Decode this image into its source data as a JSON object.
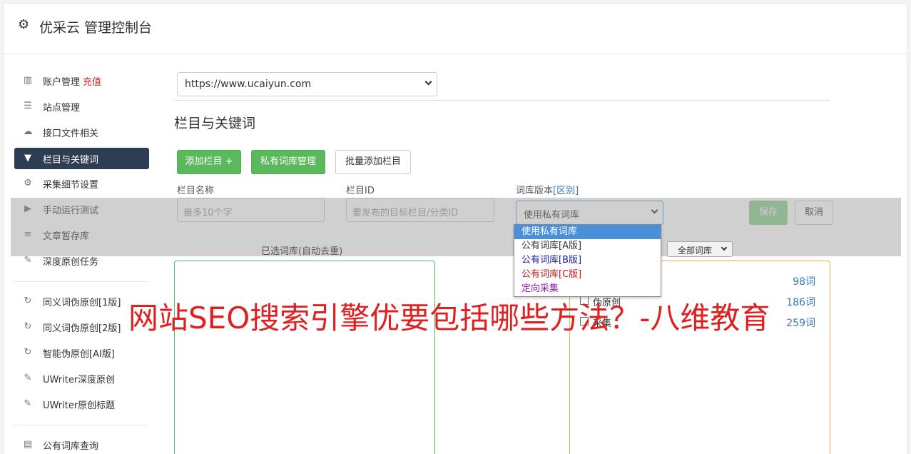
{
  "header": {
    "title": "优采云 管理控制台",
    "icon": "gear-icon"
  },
  "sidebar": {
    "items": [
      {
        "label": "账户管理",
        "badge": "充值",
        "icon": "bar-chart-icon"
      },
      {
        "label": "站点管理",
        "icon": "server-icon"
      },
      {
        "label": "接口文件相关",
        "icon": "cloud-upload-icon"
      },
      {
        "label": "栏目与关键词",
        "icon": "filter-icon",
        "active": true
      },
      {
        "label": "采集细节设置",
        "icon": "cogs-icon"
      },
      {
        "label": "手动运行测试",
        "icon": "play-circle-icon"
      },
      {
        "label": "文章暂存库",
        "icon": "database-icon"
      },
      {
        "label": "深度原创任务",
        "icon": "edit-icon"
      },
      {
        "label": "同义词伪原创[1版]",
        "icon": "refresh-icon"
      },
      {
        "label": "同义词伪原创[2版]",
        "icon": "refresh-icon"
      },
      {
        "label": "智能伪原创[AI版]",
        "icon": "refresh-icon"
      },
      {
        "label": "UWriter深度原创",
        "icon": "edit-icon"
      },
      {
        "label": "UWriter原创标题",
        "icon": "edit-icon"
      },
      {
        "label": "公有词库查询",
        "icon": "book-icon"
      }
    ]
  },
  "site_select": {
    "value": "https://www.ucaiyun.com"
  },
  "section": {
    "title": "栏目与关键词",
    "add_button": "添加栏目 +",
    "private_lib_button": "私有词库管理",
    "batch_add_button": "批量添加栏目"
  },
  "form": {
    "name_label": "栏目名称",
    "name_placeholder": "最多10个字",
    "id_label": "栏目ID",
    "id_placeholder": "要发布的目标栏目/分类ID",
    "version_label": "词库版本",
    "version_link": "[区别]",
    "version_value": "使用私有词库",
    "save_button": "保存",
    "cancel_button": "取消"
  },
  "dropdown": {
    "options": [
      {
        "label": "使用私有词库",
        "color": "#ffffff"
      },
      {
        "label": "公有词库[A版]",
        "color": "#333333"
      },
      {
        "label": "公有词库[B版]",
        "color": "#1a1aa6"
      },
      {
        "label": "公有词库[C版]",
        "color": "#c41a1a"
      },
      {
        "label": "定向采集",
        "color": "#8a1ab0"
      }
    ]
  },
  "selected_lib": {
    "label": "已选词库(自动去重)"
  },
  "lib_filter": {
    "value": "全部词库"
  },
  "lib_list": [
    {
      "name": "",
      "count": "98词"
    },
    {
      "name": "伪原创",
      "count": "186词"
    },
    {
      "name": "采集",
      "count": "259词"
    }
  ],
  "watermark": "网站SEO搜索引擎优要包括哪些方法？-八维教育"
}
